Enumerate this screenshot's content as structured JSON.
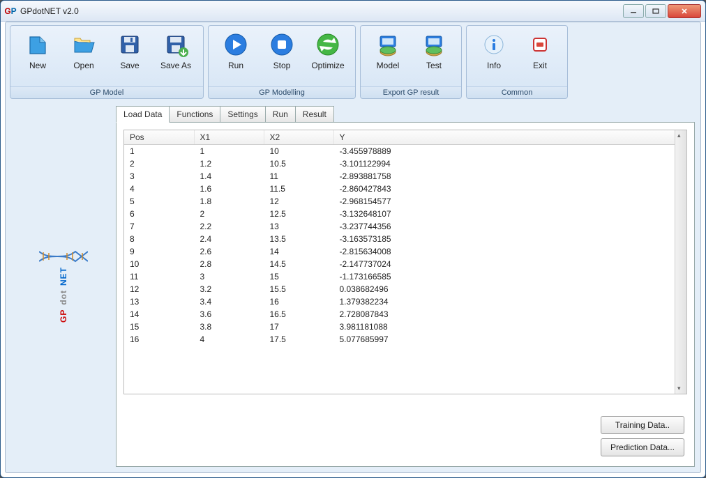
{
  "window": {
    "title": "GPdotNET v2.0"
  },
  "ribbon": {
    "groups": [
      {
        "label": "GP Model",
        "items": [
          {
            "key": "new",
            "label": "New"
          },
          {
            "key": "open",
            "label": "Open"
          },
          {
            "key": "save",
            "label": "Save"
          },
          {
            "key": "saveas",
            "label": "Save As"
          }
        ]
      },
      {
        "label": "GP Modelling",
        "items": [
          {
            "key": "run",
            "label": "Run"
          },
          {
            "key": "stop",
            "label": "Stop"
          },
          {
            "key": "optimize",
            "label": "Optimize"
          }
        ]
      },
      {
        "label": "Export GP result",
        "items": [
          {
            "key": "model",
            "label": "Model"
          },
          {
            "key": "test",
            "label": "Test"
          }
        ]
      },
      {
        "label": "Common",
        "items": [
          {
            "key": "info",
            "label": "Info"
          },
          {
            "key": "exit",
            "label": "Exit"
          }
        ]
      }
    ]
  },
  "tabs": [
    "Load Data",
    "Functions",
    "Settings",
    "Run",
    "Result"
  ],
  "active_tab": "Load Data",
  "grid": {
    "headers": [
      "Pos",
      "X1",
      "X2",
      "Y"
    ],
    "rows": [
      [
        "1",
        "1",
        "10",
        "-3.455978889"
      ],
      [
        "2",
        "1.2",
        "10.5",
        "-3.101122994"
      ],
      [
        "3",
        "1.4",
        "11",
        "-2.893881758"
      ],
      [
        "4",
        "1.6",
        "11.5",
        "-2.860427843"
      ],
      [
        "5",
        "1.8",
        "12",
        "-2.968154577"
      ],
      [
        "6",
        "2",
        "12.5",
        "-3.132648107"
      ],
      [
        "7",
        "2.2",
        "13",
        "-3.237744356"
      ],
      [
        "8",
        "2.4",
        "13.5",
        "-3.163573185"
      ],
      [
        "9",
        "2.6",
        "14",
        "-2.815634008"
      ],
      [
        "10",
        "2.8",
        "14.5",
        "-2.147737024"
      ],
      [
        "11",
        "3",
        "15",
        "-1.173166585"
      ],
      [
        "12",
        "3.2",
        "15.5",
        "0.038682496"
      ],
      [
        "13",
        "3.4",
        "16",
        "1.379382234"
      ],
      [
        "14",
        "3.6",
        "16.5",
        "2.728087843"
      ],
      [
        "15",
        "3.8",
        "17",
        "3.981181088"
      ],
      [
        "16",
        "4",
        "17.5",
        "5.077685997"
      ]
    ]
  },
  "buttons": {
    "training": "Training Data..",
    "prediction": "Prediction Data..."
  }
}
